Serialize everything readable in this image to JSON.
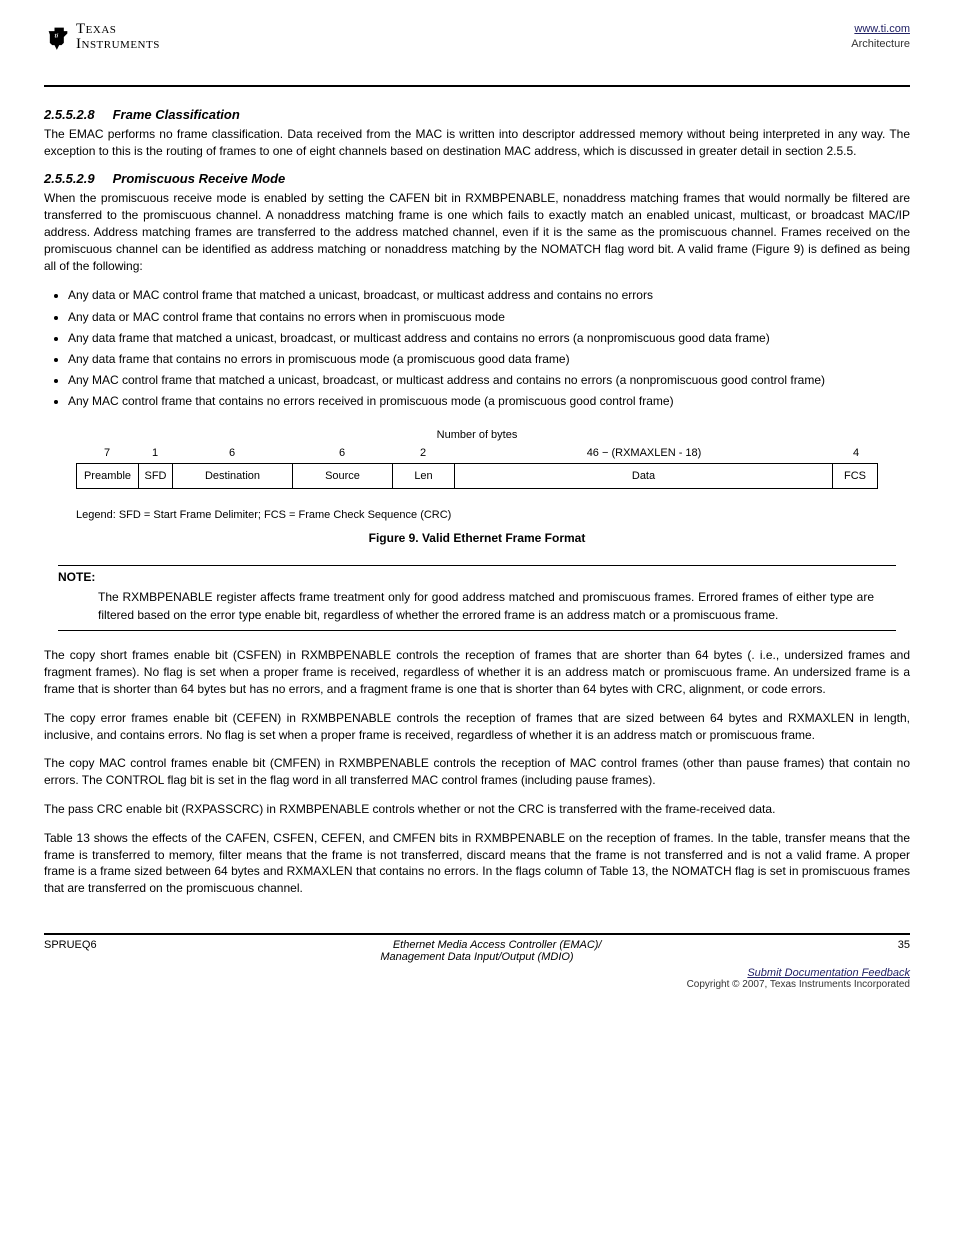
{
  "header": {
    "logo_line1": "Texas",
    "logo_line2": "Instruments",
    "link": "www.ti.com",
    "right_title": "Architecture"
  },
  "s1": {
    "num": "2.5.5.2.8",
    "title": "Frame Classification",
    "p1": "The EMAC performs no frame classification. Data received from the MAC is written into descriptor addressed memory without being interpreted in any way. The exception to this is the routing of frames to one of eight channels based on destination MAC address, which is discussed in greater detail in section 2.5.5."
  },
  "s2": {
    "num": "2.5.5.2.9",
    "title": "Promiscuous Receive Mode",
    "intro": "When the promiscuous receive mode is enabled by setting the CAFEN bit in RXMBPENABLE, nonaddress matching frames that would normally be filtered are transferred to the promiscuous channel. A nonaddress matching frame is one which fails to exactly match an enabled unicast, multicast, or broadcast MAC/IP address. Address matching frames are transferred to the address matched channel, even if it is the same as the promiscuous channel. Frames received on the promiscuous channel can be identified as address matching or nonaddress matching by the NOMATCH flag word bit. A valid frame (Figure 9) is defined as being all of the following:",
    "b1": "Any data or MAC control frame that matched a unicast, broadcast, or multicast address and contains no errors",
    "b2": "Any data or MAC control frame that contains no errors when in promiscuous mode",
    "b3": "Any data frame that matched a unicast, broadcast, or multicast address and contains no errors (a nonpromiscuous good data frame)",
    "b4": "Any data frame that contains no errors in promiscuous mode (a promiscuous good data frame)",
    "b5": "Any MAC control frame that matched a unicast, broadcast, or multicast address and contains no errors (a nonpromiscuous good control frame)",
    "b6": "Any MAC control frame that contains no errors received in promiscuous mode (a promiscuous good control frame)"
  },
  "fig": {
    "title": "Number of bytes",
    "bytes": {
      "pre": "7",
      "sfd": "1",
      "dst": "6",
      "src": "6",
      "len": "2",
      "data": "46 − (RXMAXLEN - 18)",
      "fcs": "4"
    },
    "cells": {
      "pre": "Preamble",
      "sfd": "SFD",
      "dst": "Destination",
      "src": "Source",
      "len": "Len",
      "data": "Data",
      "fcs": "FCS"
    },
    "legend": "Legend: SFD = Start Frame Delimiter; FCS = Frame Check Sequence (CRC)",
    "caption": "Figure 9. Valid Ethernet Frame Format"
  },
  "note": {
    "label": "NOTE:",
    "text": "The RXMBPENABLE register affects frame treatment only for good address matched and promiscuous frames. Errored frames of either type are filtered based on the error type enable bit, regardless of whether the errored frame is an address match or a promiscuous frame."
  },
  "p3": "The copy short frames enable bit (CSFEN) in RXMBPENABLE controls the reception of frames that are shorter than 64 bytes (. i.e., undersized frames and fragment frames). No flag is set when a proper frame is received, regardless of whether it is an address match or promiscuous frame. An undersized frame is a frame that is shorter than 64 bytes but has no errors, and a fragment frame is one that is shorter than 64 bytes with CRC, alignment, or code errors.",
  "p4": "The copy error frames enable bit (CEFEN) in RXMBPENABLE controls the reception of frames that are sized between 64 bytes and RXMAXLEN in length, inclusive, and contains errors. No flag is set when a proper frame is received, regardless of whether it is an address match or promiscuous frame.",
  "p5": "The copy MAC control frames enable bit (CMFEN) in RXMBPENABLE controls the reception of MAC control frames (other than pause frames) that contain no errors. The CONTROL flag bit is set in the flag word in all transferred MAC control frames (including pause frames).",
  "p6": "The pass CRC enable bit (RXPASSCRC) in RXMBPENABLE controls whether or not the CRC is transferred with the frame-received data.",
  "p7": "Table 13 shows the effects of the CAFEN, CSFEN, CEFEN, and CMFEN bits in RXMBPENABLE on the reception of frames. In the table, transfer means that the frame is transferred to memory, filter means that the frame is not transferred, discard means that the frame is not transferred and is not a valid frame. A proper frame is a frame sized between 64 bytes and RXMAXLEN that contains no errors. In the flags column of Table 13, the NOMATCH flag is set in promiscuous frames that are transferred on the promiscuous channel.",
  "footer": {
    "left": "SPRUEQ6",
    "mid_1": "Ethernet Media Access Controller (EMAC)/",
    "mid_2": "Management Data Input/Output (MDIO)",
    "right": "35",
    "sub1": "Submit Documentation Feedback",
    "copy": "Copyright © 2007, Texas Instruments Incorporated"
  }
}
